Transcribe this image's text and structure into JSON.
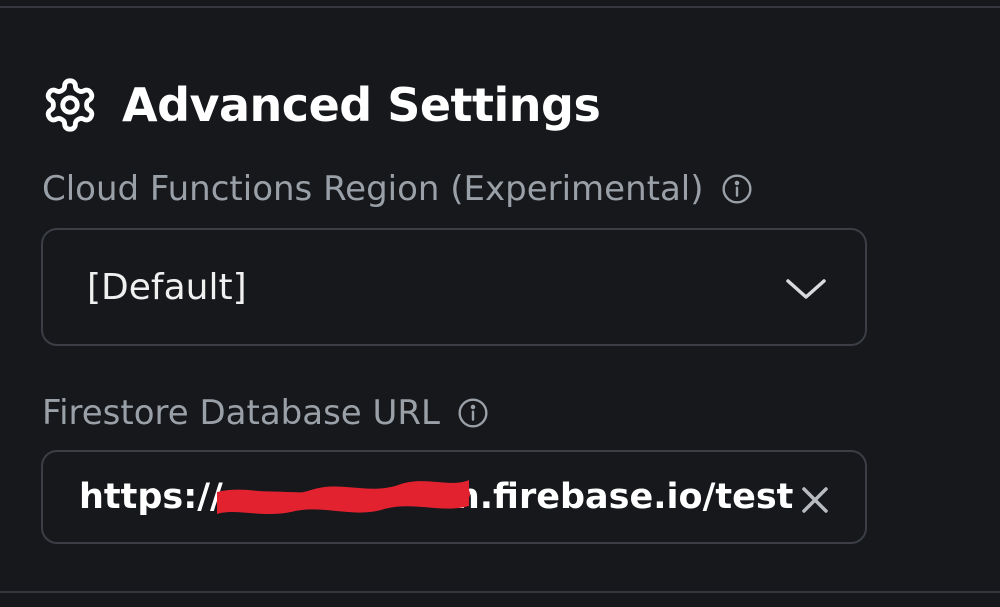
{
  "section": {
    "icon": "gear-icon",
    "title": "Advanced Settings"
  },
  "region_field": {
    "label": "Cloud Functions Region (Experimental)",
    "info_icon": "info-icon",
    "value": "[Default]",
    "dropdown_icon": "chevron-down-icon"
  },
  "url_field": {
    "label": "Firestore Database URL",
    "info_icon": "info-icon",
    "value": "https://",
    "value_suffix": "n.firebase.io/test",
    "clear_icon": "close-icon"
  },
  "colors": {
    "background": "#16181c",
    "border": "#3b3e45",
    "label": "#9aa0a8",
    "text": "#ffffff",
    "redaction": "#e2222f"
  }
}
